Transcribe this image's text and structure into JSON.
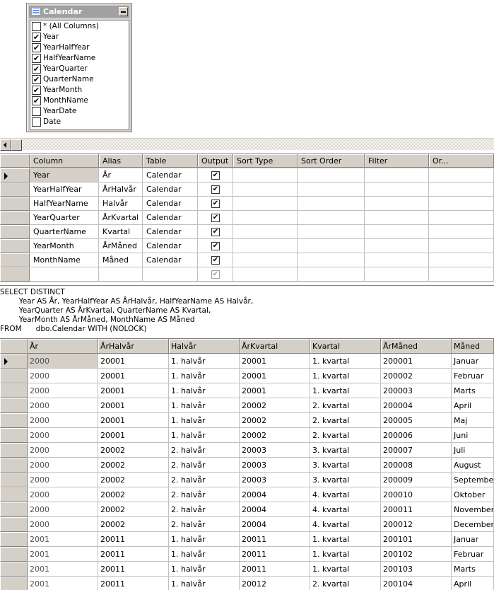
{
  "diagram": {
    "table_title": "Calendar",
    "columns": [
      {
        "label": "* (All Columns)",
        "checked": false
      },
      {
        "label": "Year",
        "checked": true
      },
      {
        "label": "YearHalfYear",
        "checked": true
      },
      {
        "label": "HalfYearName",
        "checked": true
      },
      {
        "label": "YearQuarter",
        "checked": true
      },
      {
        "label": "QuarterName",
        "checked": true
      },
      {
        "label": "YearMonth",
        "checked": true
      },
      {
        "label": "MonthName",
        "checked": true
      },
      {
        "label": "YearDate",
        "checked": false
      },
      {
        "label": "Date",
        "checked": false
      }
    ]
  },
  "criteria": {
    "headers": [
      "Column",
      "Alias",
      "Table",
      "Output",
      "Sort Type",
      "Sort Order",
      "Filter",
      "Or..."
    ],
    "rows": [
      {
        "column": "Year",
        "alias": "År",
        "table": "Calendar",
        "output": true
      },
      {
        "column": "YearHalfYear",
        "alias": "ÅrHalvår",
        "table": "Calendar",
        "output": true
      },
      {
        "column": "HalfYearName",
        "alias": "Halvår",
        "table": "Calendar",
        "output": true
      },
      {
        "column": "YearQuarter",
        "alias": "ÅrKvartal",
        "table": "Calendar",
        "output": true
      },
      {
        "column": "QuarterName",
        "alias": "Kvartal",
        "table": "Calendar",
        "output": true
      },
      {
        "column": "YearMonth",
        "alias": "ÅrMåned",
        "table": "Calendar",
        "output": true
      },
      {
        "column": "MonthName",
        "alias": "Måned",
        "table": "Calendar",
        "output": true
      },
      {
        "column": "",
        "alias": "",
        "table": "",
        "output": "dim"
      }
    ]
  },
  "sql": {
    "lines": [
      "SELECT DISTINCT",
      "        Year AS År, YearHalfYear AS ÅrHalvår, HalfYearName AS Halvår,",
      "        YearQuarter AS ÅrKvartal, QuarterName AS Kvartal,",
      "        YearMonth AS ÅrMåned, MonthName AS Måned",
      "FROM      dbo.Calendar WITH (NOLOCK)"
    ]
  },
  "results": {
    "headers": [
      "År",
      "ÅrHalvår",
      "Halvår",
      "ÅrKvartal",
      "Kvartal",
      "ÅrMåned",
      "Måned"
    ],
    "rows": [
      [
        "2000",
        "20001",
        "1. halvår",
        "20001",
        "1. kvartal",
        "200001",
        "Januar"
      ],
      [
        "2000",
        "20001",
        "1. halvår",
        "20001",
        "1. kvartal",
        "200002",
        "Februar"
      ],
      [
        "2000",
        "20001",
        "1. halvår",
        "20001",
        "1. kvartal",
        "200003",
        "Marts"
      ],
      [
        "2000",
        "20001",
        "1. halvår",
        "20002",
        "2. kvartal",
        "200004",
        "April"
      ],
      [
        "2000",
        "20001",
        "1. halvår",
        "20002",
        "2. kvartal",
        "200005",
        "Maj"
      ],
      [
        "2000",
        "20001",
        "1. halvår",
        "20002",
        "2. kvartal",
        "200006",
        "Juni"
      ],
      [
        "2000",
        "20002",
        "2. halvår",
        "20003",
        "3. kvartal",
        "200007",
        "Juli"
      ],
      [
        "2000",
        "20002",
        "2. halvår",
        "20003",
        "3. kvartal",
        "200008",
        "August"
      ],
      [
        "2000",
        "20002",
        "2. halvår",
        "20003",
        "3. kvartal",
        "200009",
        "September"
      ],
      [
        "2000",
        "20002",
        "2. halvår",
        "20004",
        "4. kvartal",
        "200010",
        "Oktober"
      ],
      [
        "2000",
        "20002",
        "2. halvår",
        "20004",
        "4. kvartal",
        "200011",
        "November"
      ],
      [
        "2000",
        "20002",
        "2. halvår",
        "20004",
        "4. kvartal",
        "200012",
        "December"
      ],
      [
        "2001",
        "20011",
        "1. halvår",
        "20011",
        "1. kvartal",
        "200101",
        "Januar"
      ],
      [
        "2001",
        "20011",
        "1. halvår",
        "20011",
        "1. kvartal",
        "200102",
        "Februar"
      ],
      [
        "2001",
        "20011",
        "1. halvår",
        "20011",
        "1. kvartal",
        "200103",
        "Marts"
      ],
      [
        "2001",
        "20011",
        "1. halvår",
        "20012",
        "2. kvartal",
        "200104",
        "April"
      ]
    ]
  }
}
